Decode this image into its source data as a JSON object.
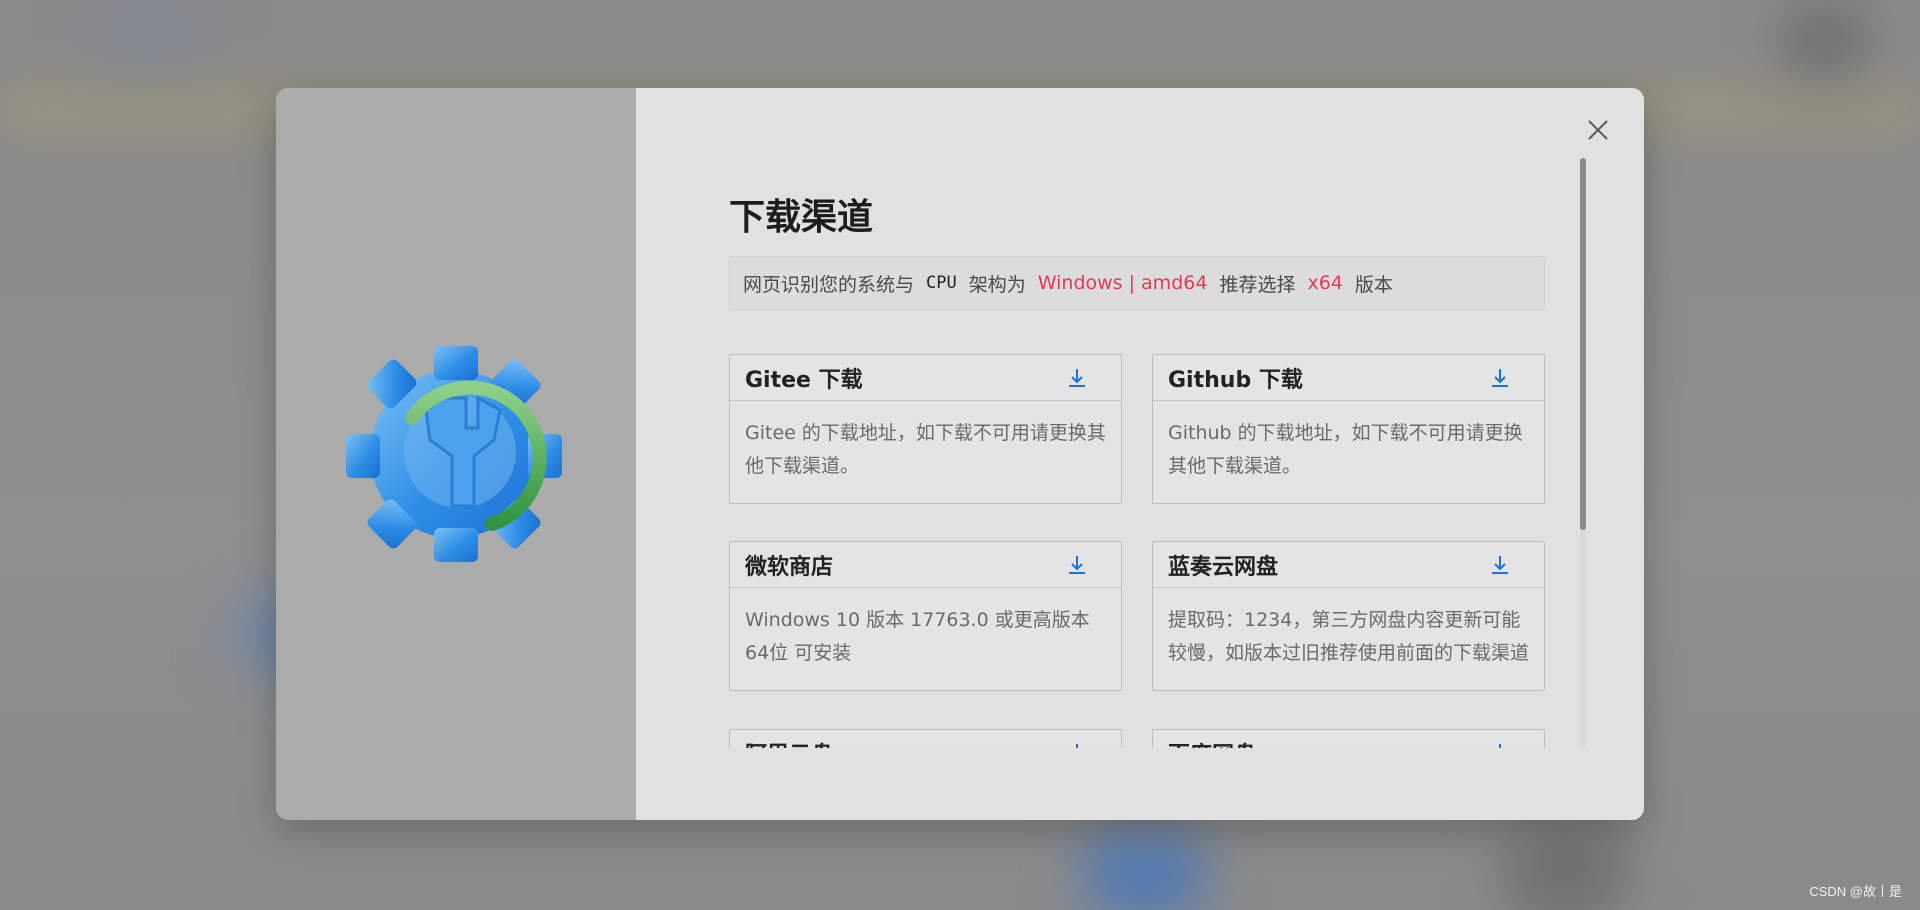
{
  "modal": {
    "title": "下载渠道",
    "close_icon": "close-icon",
    "logo_icon": "gear-wrench-logo"
  },
  "notice": {
    "prefix": "网页识别您的系统与",
    "cpu": "CPU",
    "mid": "架构为",
    "system": "Windows | amd64",
    "recommend": "推荐选择",
    "version": "x64",
    "suffix": "版本"
  },
  "channels": [
    {
      "title": "Gitee 下载",
      "desc": "Gitee 的下载地址，如下载不可用请更换其他下载渠道。",
      "icon": "download-icon"
    },
    {
      "title": "Github 下载",
      "desc": "Github 的下载地址，如下载不可用请更换其他下载渠道。",
      "icon": "download-icon"
    },
    {
      "title": "微软商店",
      "desc": "Windows 10 版本 17763.0 或更高版本 64位 可安装",
      "icon": "download-icon"
    },
    {
      "title": "蓝奏云网盘",
      "desc": "提取码：1234，第三方网盘内容更新可能较慢，如版本过旧推荐使用前面的下载渠道",
      "icon": "download-icon"
    },
    {
      "title": "阿里云盘",
      "desc": "",
      "icon": "download-icon"
    },
    {
      "title": "百度网盘",
      "desc": "",
      "icon": "download-icon"
    }
  ],
  "colors": {
    "accent": "#e23a55",
    "download_icon": "#1a73d9",
    "logo_blue": "#2e8ee6",
    "logo_green": "#3fa84a"
  },
  "watermark": "CSDN @故丨是"
}
